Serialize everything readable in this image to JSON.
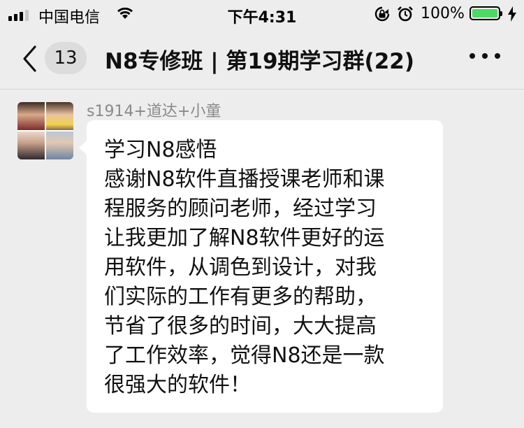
{
  "status_bar": {
    "carrier": "中国电信",
    "time": "下午4:31",
    "battery_percent": "100%",
    "battery_level": 1.0,
    "signal_bars_filled": 3,
    "signal_bars_total": 4
  },
  "nav_bar": {
    "unread_count": "13",
    "title": "N8专修班 | 第19期学习群(22)"
  },
  "message": {
    "sender": "s1914+道达+小童",
    "lines": [
      "学习N8感悟",
      "感谢N8软件直播授课老师和课",
      "程服务的顾问老师，经过学习",
      "让我更加了解N8软件更好的运",
      "用软件，从调色到设计，对我",
      "们实际的工作有更多的帮助，",
      "节省了很多的时间，大大提高",
      "了工作效率，觉得N8还是一款",
      "很强大的软件！"
    ]
  },
  "colors": {
    "background": "#ededed",
    "bubble": "#ffffff",
    "battery_fill": "#4cd964",
    "sender_text": "#8a8a8a"
  },
  "icons": [
    "signal-icon",
    "wifi-icon",
    "lock-rotation-icon",
    "alarm-icon",
    "battery-icon",
    "charging-icon",
    "back-chevron-icon",
    "more-dots-icon"
  ]
}
